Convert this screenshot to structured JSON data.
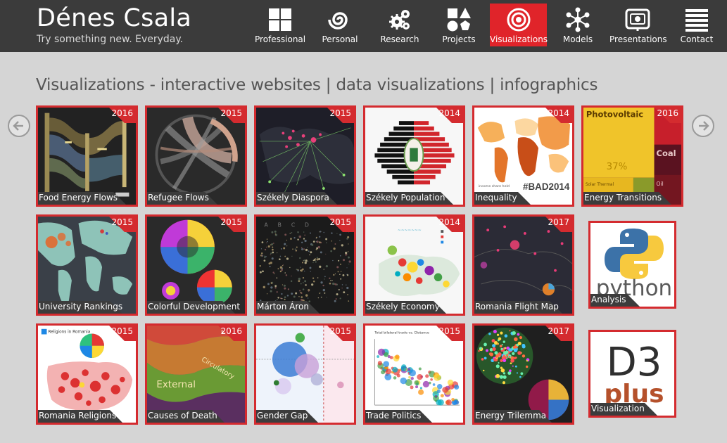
{
  "brand": {
    "title": "Dénes Csala",
    "subtitle": "Try something new. Everyday."
  },
  "nav": [
    {
      "label": "Professional",
      "icon": "grid-icon",
      "active": false
    },
    {
      "label": "Personal",
      "icon": "spiral-icon",
      "active": false
    },
    {
      "label": "Research",
      "icon": "gears-icon",
      "active": false
    },
    {
      "label": "Projects",
      "icon": "shapes-icon",
      "active": false
    },
    {
      "label": "Visualizations",
      "icon": "target-icon",
      "active": true
    },
    {
      "label": "Models",
      "icon": "network-icon",
      "active": false
    },
    {
      "label": "Presentations",
      "icon": "presentation-icon",
      "active": false
    },
    {
      "label": "Contact",
      "icon": "menu-lines-icon",
      "active": false
    }
  ],
  "section": {
    "title": "Visualizations - interactive websites | data visualizations | infographics"
  },
  "tiles": [
    {
      "caption": "Food Energy Flows",
      "year": "2016"
    },
    {
      "caption": "Refugee Flows",
      "year": "2015"
    },
    {
      "caption": "Székely Diaspora",
      "year": "2015"
    },
    {
      "caption": "Székely Population",
      "year": "2014"
    },
    {
      "caption": "Inequality",
      "year": "2014"
    },
    {
      "caption": "Energy Transitions",
      "year": "2016"
    },
    {
      "caption": "University Rankings",
      "year": "2015"
    },
    {
      "caption": "Colorful Development",
      "year": "2015"
    },
    {
      "caption": "Márton Áron",
      "year": "2015"
    },
    {
      "caption": "Székely Economy",
      "year": "2014"
    },
    {
      "caption": "Romania Flight Map",
      "year": "2017"
    },
    {
      "caption": "Romania Religions",
      "year": "2015"
    },
    {
      "caption": "Causes of Death",
      "year": "2016"
    },
    {
      "caption": "Gender Gap",
      "year": "2015"
    },
    {
      "caption": "Trade Politics",
      "year": "2015"
    },
    {
      "caption": "Energy Trilemma",
      "year": "2017"
    }
  ],
  "logo_tiles": [
    {
      "caption": "Analysis",
      "logo_text": "python"
    },
    {
      "caption": "Visualization",
      "logo_text_top": "D3",
      "logo_text_bottom": "plus"
    }
  ],
  "thumb_text": {
    "photovoltaic": "Photovoltaic",
    "pct": "37%",
    "coal": "Coal",
    "solar_thermal": "Solar Thermal",
    "oil": "Oil",
    "bad2014": "#BAD2014",
    "external": "External",
    "circulatory": "Circulatory",
    "religions_title": "Religions in Romania"
  },
  "colors": {
    "header_bg": "#3b3b3b",
    "accent": "#e0242a",
    "tile_border": "#d42b2f",
    "page_bg": "#d5d5d5"
  }
}
